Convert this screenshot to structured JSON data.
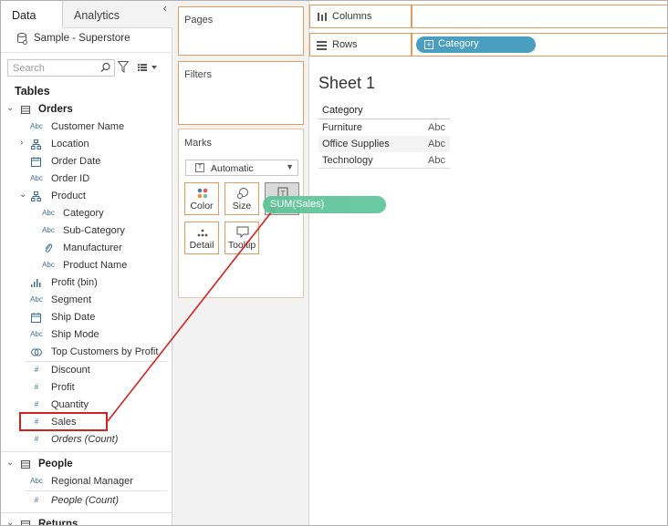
{
  "tabs": {
    "data": "Data",
    "analytics": "Analytics",
    "collapse": "‹"
  },
  "datasource": "Sample - Superstore",
  "search": {
    "placeholder": "Search"
  },
  "tables_header": "Tables",
  "orders": {
    "label": "Orders",
    "fields": {
      "customer_name": "Customer Name",
      "location": "Location",
      "order_date": "Order Date",
      "order_id": "Order ID",
      "product": "Product",
      "category": "Category",
      "sub_category": "Sub-Category",
      "manufacturer": "Manufacturer",
      "product_name": "Product Name",
      "profit_bin": "Profit (bin)",
      "segment": "Segment",
      "ship_date": "Ship Date",
      "ship_mode": "Ship Mode",
      "top_customers": "Top Customers by Profit",
      "discount": "Discount",
      "profit": "Profit",
      "quantity": "Quantity",
      "sales": "Sales",
      "orders_count": "Orders (Count)"
    }
  },
  "people": {
    "label": "People",
    "fields": {
      "regional_manager": "Regional Manager",
      "people_count": "People (Count)"
    }
  },
  "returns": {
    "label": "Returns"
  },
  "type_abbr": "Abc",
  "number_glyph": "#",
  "cards": {
    "pages": "Pages",
    "filters": "Filters",
    "marks": "Marks",
    "mark_type": "Automatic",
    "color": "Color",
    "size": "Size",
    "detail": "Detail",
    "tooltip": "Tooltip"
  },
  "shelves": {
    "columns": "Columns",
    "rows": "Rows",
    "rows_pill": "Category"
  },
  "sheet": {
    "title": "Sheet 1",
    "header": "Category",
    "rows": [
      {
        "label": "Furniture",
        "value": "Abc"
      },
      {
        "label": "Office Supplies",
        "value": "Abc"
      },
      {
        "label": "Technology",
        "value": "Abc"
      }
    ]
  },
  "drag_pill": "SUM(Sales)",
  "colors": {
    "highlight_box": "#d62020",
    "rows_pill": "#4a9ebf",
    "drag_pill": "#5ec49a",
    "card_border": "#e39b5b"
  }
}
